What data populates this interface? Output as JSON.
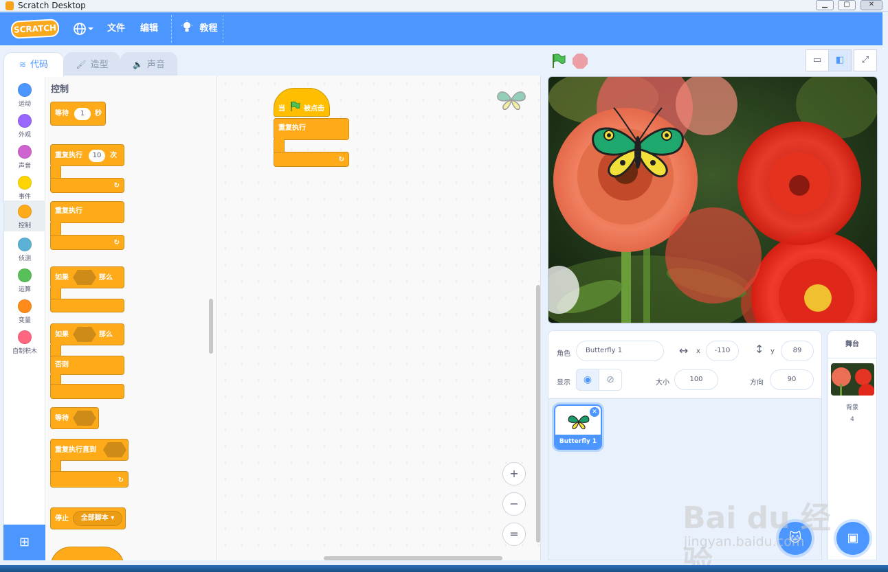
{
  "window": {
    "title": "Scratch Desktop",
    "min": "▁",
    "max": "▢",
    "close": "✕"
  },
  "menubar": {
    "logo": "SCRATCH",
    "items": [
      {
        "label": "文件"
      },
      {
        "label": "编辑"
      },
      {
        "label": "教程"
      }
    ]
  },
  "tabs": [
    {
      "label": "代码",
      "icon": "code-icon"
    },
    {
      "label": "造型",
      "icon": "brush-icon"
    },
    {
      "label": "声音",
      "icon": "speaker-icon"
    }
  ],
  "categories": [
    {
      "label": "运动",
      "color": "#4c97ff"
    },
    {
      "label": "外观",
      "color": "#9966ff"
    },
    {
      "label": "声音",
      "color": "#cf63cf"
    },
    {
      "label": "事件",
      "color": "#ffd500"
    },
    {
      "label": "控制",
      "color": "#ffab19"
    },
    {
      "label": "侦测",
      "color": "#5cb1d6"
    },
    {
      "label": "运算",
      "color": "#59c059"
    },
    {
      "label": "变量",
      "color": "#ff8c1a"
    },
    {
      "label": "自制积木",
      "color": "#ff6680"
    }
  ],
  "palette": {
    "heading": "控制",
    "wait": {
      "label": "等待",
      "value": "1",
      "unit": "秒"
    },
    "repeat": {
      "label": "重复执行",
      "value": "10",
      "unit": "次"
    },
    "forever": {
      "label": "重复执行"
    },
    "if_then": {
      "if": "如果",
      "then": "那么"
    },
    "if_else": {
      "if": "如果",
      "then": "那么",
      "else": "否则"
    },
    "wait_until": {
      "label": "等待"
    },
    "repeat_until": {
      "label": "重复执行直到"
    },
    "stop": {
      "label": "停止",
      "option": "全部脚本"
    }
  },
  "script": {
    "hat": {
      "when": "当",
      "clicked": "被点击"
    },
    "forever": {
      "label": "重复执行"
    }
  },
  "zoom": {
    "in": "+",
    "out": "−",
    "reset": "="
  },
  "sprite_info": {
    "sprite_label": "角色",
    "sprite_name": "Butterfly 1",
    "x_label": "x",
    "x_value": "-110",
    "y_label": "y",
    "y_value": "89",
    "show_label": "显示",
    "size_label": "大小",
    "size_value": "100",
    "direction_label": "方向",
    "direction_value": "90"
  },
  "sprites": [
    {
      "name": "Butterfly 1"
    }
  ],
  "stage_pane": {
    "title": "舞台",
    "backdrop_label": "背景",
    "backdrop_count": "4"
  },
  "watermark": {
    "line1": "Bai du 经验",
    "line2": "jingyan.baidu.com"
  },
  "colors": {
    "accent": "#4c97ff",
    "control": "#ffab19",
    "event": "#ffbf00"
  }
}
